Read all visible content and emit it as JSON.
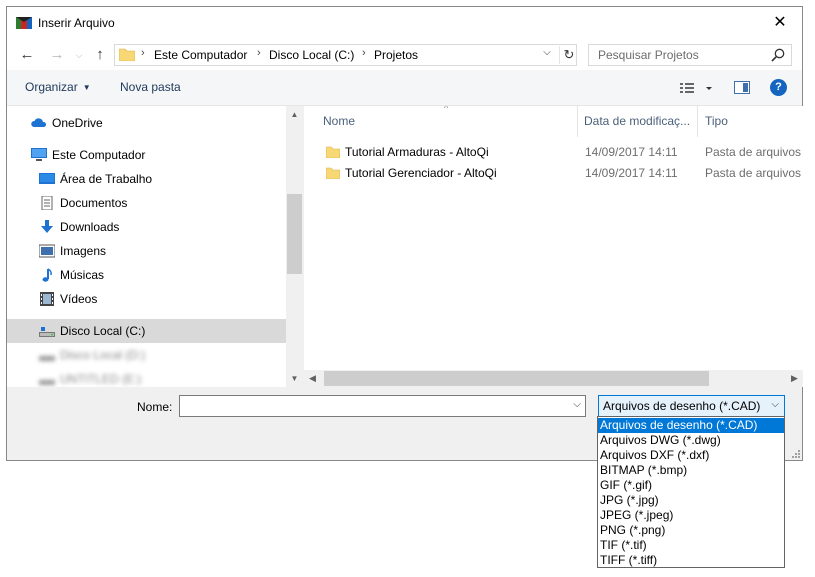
{
  "window": {
    "title": "Inserir Arquivo",
    "close_symbol": "✕"
  },
  "nav": {
    "back_symbol": "←",
    "forward_symbol": "→",
    "up_symbol": "↑",
    "dropdown_symbol": "⌵",
    "breadcrumb": [
      "Este Computador",
      "Disco Local (C:)",
      "Projetos"
    ],
    "breadcrumb_sep": "›",
    "refresh_symbol": "↻",
    "search_placeholder": "Pesquisar Projetos"
  },
  "toolbar": {
    "organize_label": "Organizar",
    "new_folder_label": "Nova pasta",
    "help_label": "?"
  },
  "sidebar": {
    "items": [
      {
        "label": "OneDrive",
        "icon": "cloud-icon"
      },
      {
        "label": "Este Computador",
        "icon": "computer-icon"
      },
      {
        "label": "Área de Trabalho",
        "icon": "desktop-icon"
      },
      {
        "label": "Documentos",
        "icon": "documents-icon"
      },
      {
        "label": "Downloads",
        "icon": "downloads-icon"
      },
      {
        "label": "Imagens",
        "icon": "pictures-icon"
      },
      {
        "label": "Músicas",
        "icon": "music-icon"
      },
      {
        "label": "Vídeos",
        "icon": "videos-icon"
      },
      {
        "label": "Disco Local (C:)",
        "icon": "drive-icon",
        "selected": true
      },
      {
        "label": "Disco Local (D:)",
        "icon": "drive-icon",
        "blurred": true
      },
      {
        "label": "UNTITLED (E:)",
        "icon": "drive-icon",
        "blurred": true
      }
    ]
  },
  "files": {
    "columns": [
      "Nome",
      "Data de modificaç...",
      "Tipo"
    ],
    "sort_symbol": "^",
    "rows": [
      {
        "name": "Tutorial Armaduras - AltoQi",
        "date": "14/09/2017 14:11",
        "type": "Pasta de arquivos"
      },
      {
        "name": "Tutorial Gerenciador - AltoQi",
        "date": "14/09/2017 14:11",
        "type": "Pasta de arquivos"
      }
    ]
  },
  "bottom": {
    "name_label": "Nome:",
    "name_value": "",
    "filter_selected": "Arquivos de desenho (*.CAD)",
    "filter_options": [
      "Arquivos de desenho (*.CAD)",
      "Arquivos DWG (*.dwg)",
      "Arquivos DXF (*.dxf)",
      "BITMAP (*.bmp)",
      "GIF (*.gif)",
      "JPG (*.jpg)",
      "JPEG (*.jpeg)",
      "PNG (*.png)",
      "TIF (*.tif)",
      "TIFF (*.tiff)"
    ]
  },
  "colors": {
    "accent": "#0078d7",
    "selection": "#d9d9d9",
    "folder": "#f8d775"
  }
}
